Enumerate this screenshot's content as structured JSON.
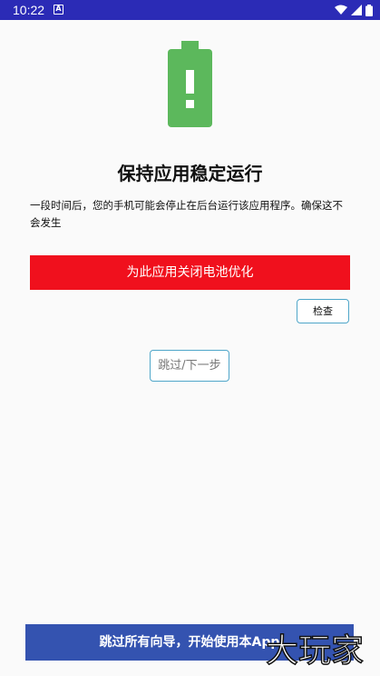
{
  "status_bar": {
    "time": "10:22",
    "app_icon_letter": "A",
    "icons": [
      "wifi-icon",
      "signal-icon",
      "battery-icon"
    ],
    "background_color": "#2b2bb6"
  },
  "hero": {
    "icon": "battery-alert-icon",
    "color": "#5cb85c"
  },
  "main": {
    "title": "保持应用稳定运行",
    "description": "一段时间后，您的手机可能会停止在后台运行该应用程序。确保这不会发生",
    "disable_optimization_label": "为此应用关闭电池优化",
    "disable_optimization_color": "#f0101d",
    "check_label": "检查",
    "skip_next_label": "跳过/下一步"
  },
  "footer": {
    "skip_all_label": "跳过所有向导，开始使用本App",
    "skip_all_color": "#3453b0"
  },
  "watermark": {
    "text": "大玩家"
  }
}
